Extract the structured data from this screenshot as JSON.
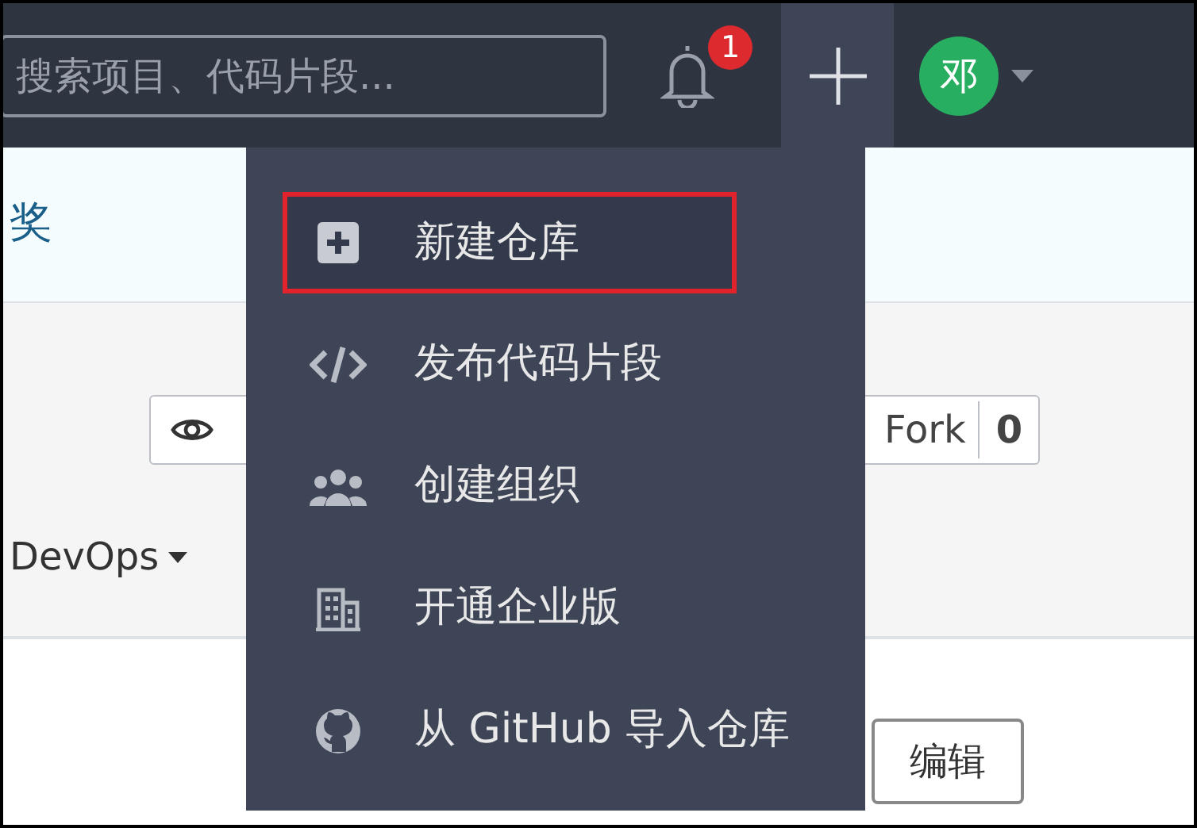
{
  "navbar": {
    "search": {
      "placeholder": "搜索项目、代码片段..."
    },
    "notifications": {
      "count": "1"
    },
    "create_button": {
      "expanded": true
    },
    "avatar": {
      "initial": "邓"
    }
  },
  "page": {
    "banner_text": "奖",
    "fork_button": {
      "label": "Fork",
      "count": "0"
    },
    "devops_menu": "DevOps",
    "edit_button": "编辑"
  },
  "create_menu": {
    "items": [
      {
        "kind": "repository",
        "label": "新建仓库",
        "selected": true,
        "outlined": true
      },
      {
        "kind": "snippet",
        "label": "发布代码片段",
        "selected": false,
        "outlined": false
      },
      {
        "kind": "organization",
        "label": "创建组织",
        "selected": false,
        "outlined": false
      },
      {
        "kind": "enterprise",
        "label": "开通企业版",
        "selected": false,
        "outlined": false
      },
      {
        "kind": "import",
        "label": "从 GitHub 导入仓库",
        "selected": false,
        "outlined": false
      }
    ]
  }
}
